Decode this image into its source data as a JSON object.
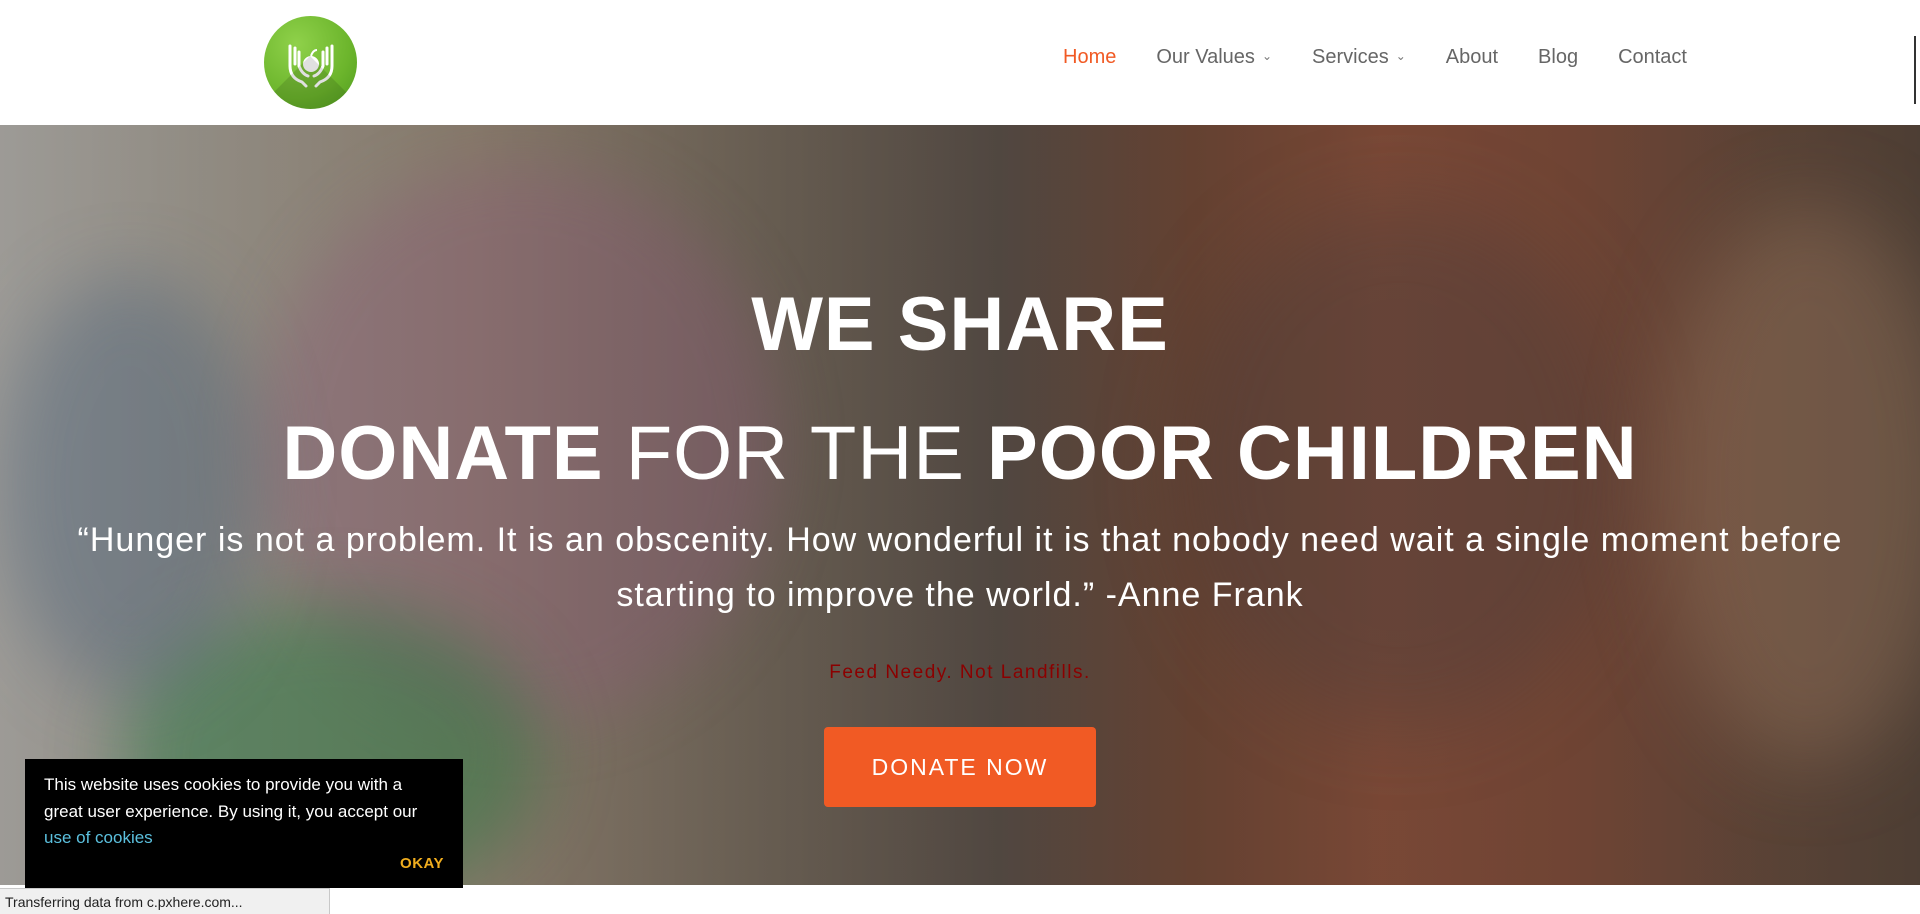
{
  "header": {
    "logo_icon": "hands-holding-apple-icon",
    "nav": [
      {
        "label": "Home",
        "active": true,
        "has_dropdown": false
      },
      {
        "label": "Our Values",
        "active": false,
        "has_dropdown": true
      },
      {
        "label": "Services",
        "active": false,
        "has_dropdown": true
      },
      {
        "label": "About",
        "active": false,
        "has_dropdown": false
      },
      {
        "label": "Blog",
        "active": false,
        "has_dropdown": false
      },
      {
        "label": "Contact",
        "active": false,
        "has_dropdown": false
      }
    ]
  },
  "hero": {
    "title_line1": "WE SHARE",
    "title_line2": {
      "part1": "DONATE",
      "part2": " FOR THE ",
      "part3": "POOR CHILDREN"
    },
    "quote_line1": "“Hunger is not a problem. It is an obscenity. How wonderful it is that nobody need wait a single moment before",
    "quote_line2": "starting to improve the world.” -Anne Frank",
    "tagline": "Feed Needy. Not Landfills.",
    "cta_label": "DONATE NOW"
  },
  "cookie_banner": {
    "text": "This website uses cookies to provide you with a great user experience. By using it, you accept our ",
    "link_label": "use of cookies",
    "ok_label": "OKAY"
  },
  "status_bar": {
    "text": "Transferring data from c.pxhere.com..."
  },
  "colors": {
    "accent": "#f15a24",
    "logo_green": "#6cb52c",
    "tagline": "#8b0000",
    "cookie_link": "#5bc0de",
    "cookie_ok": "#f0ad1e"
  }
}
